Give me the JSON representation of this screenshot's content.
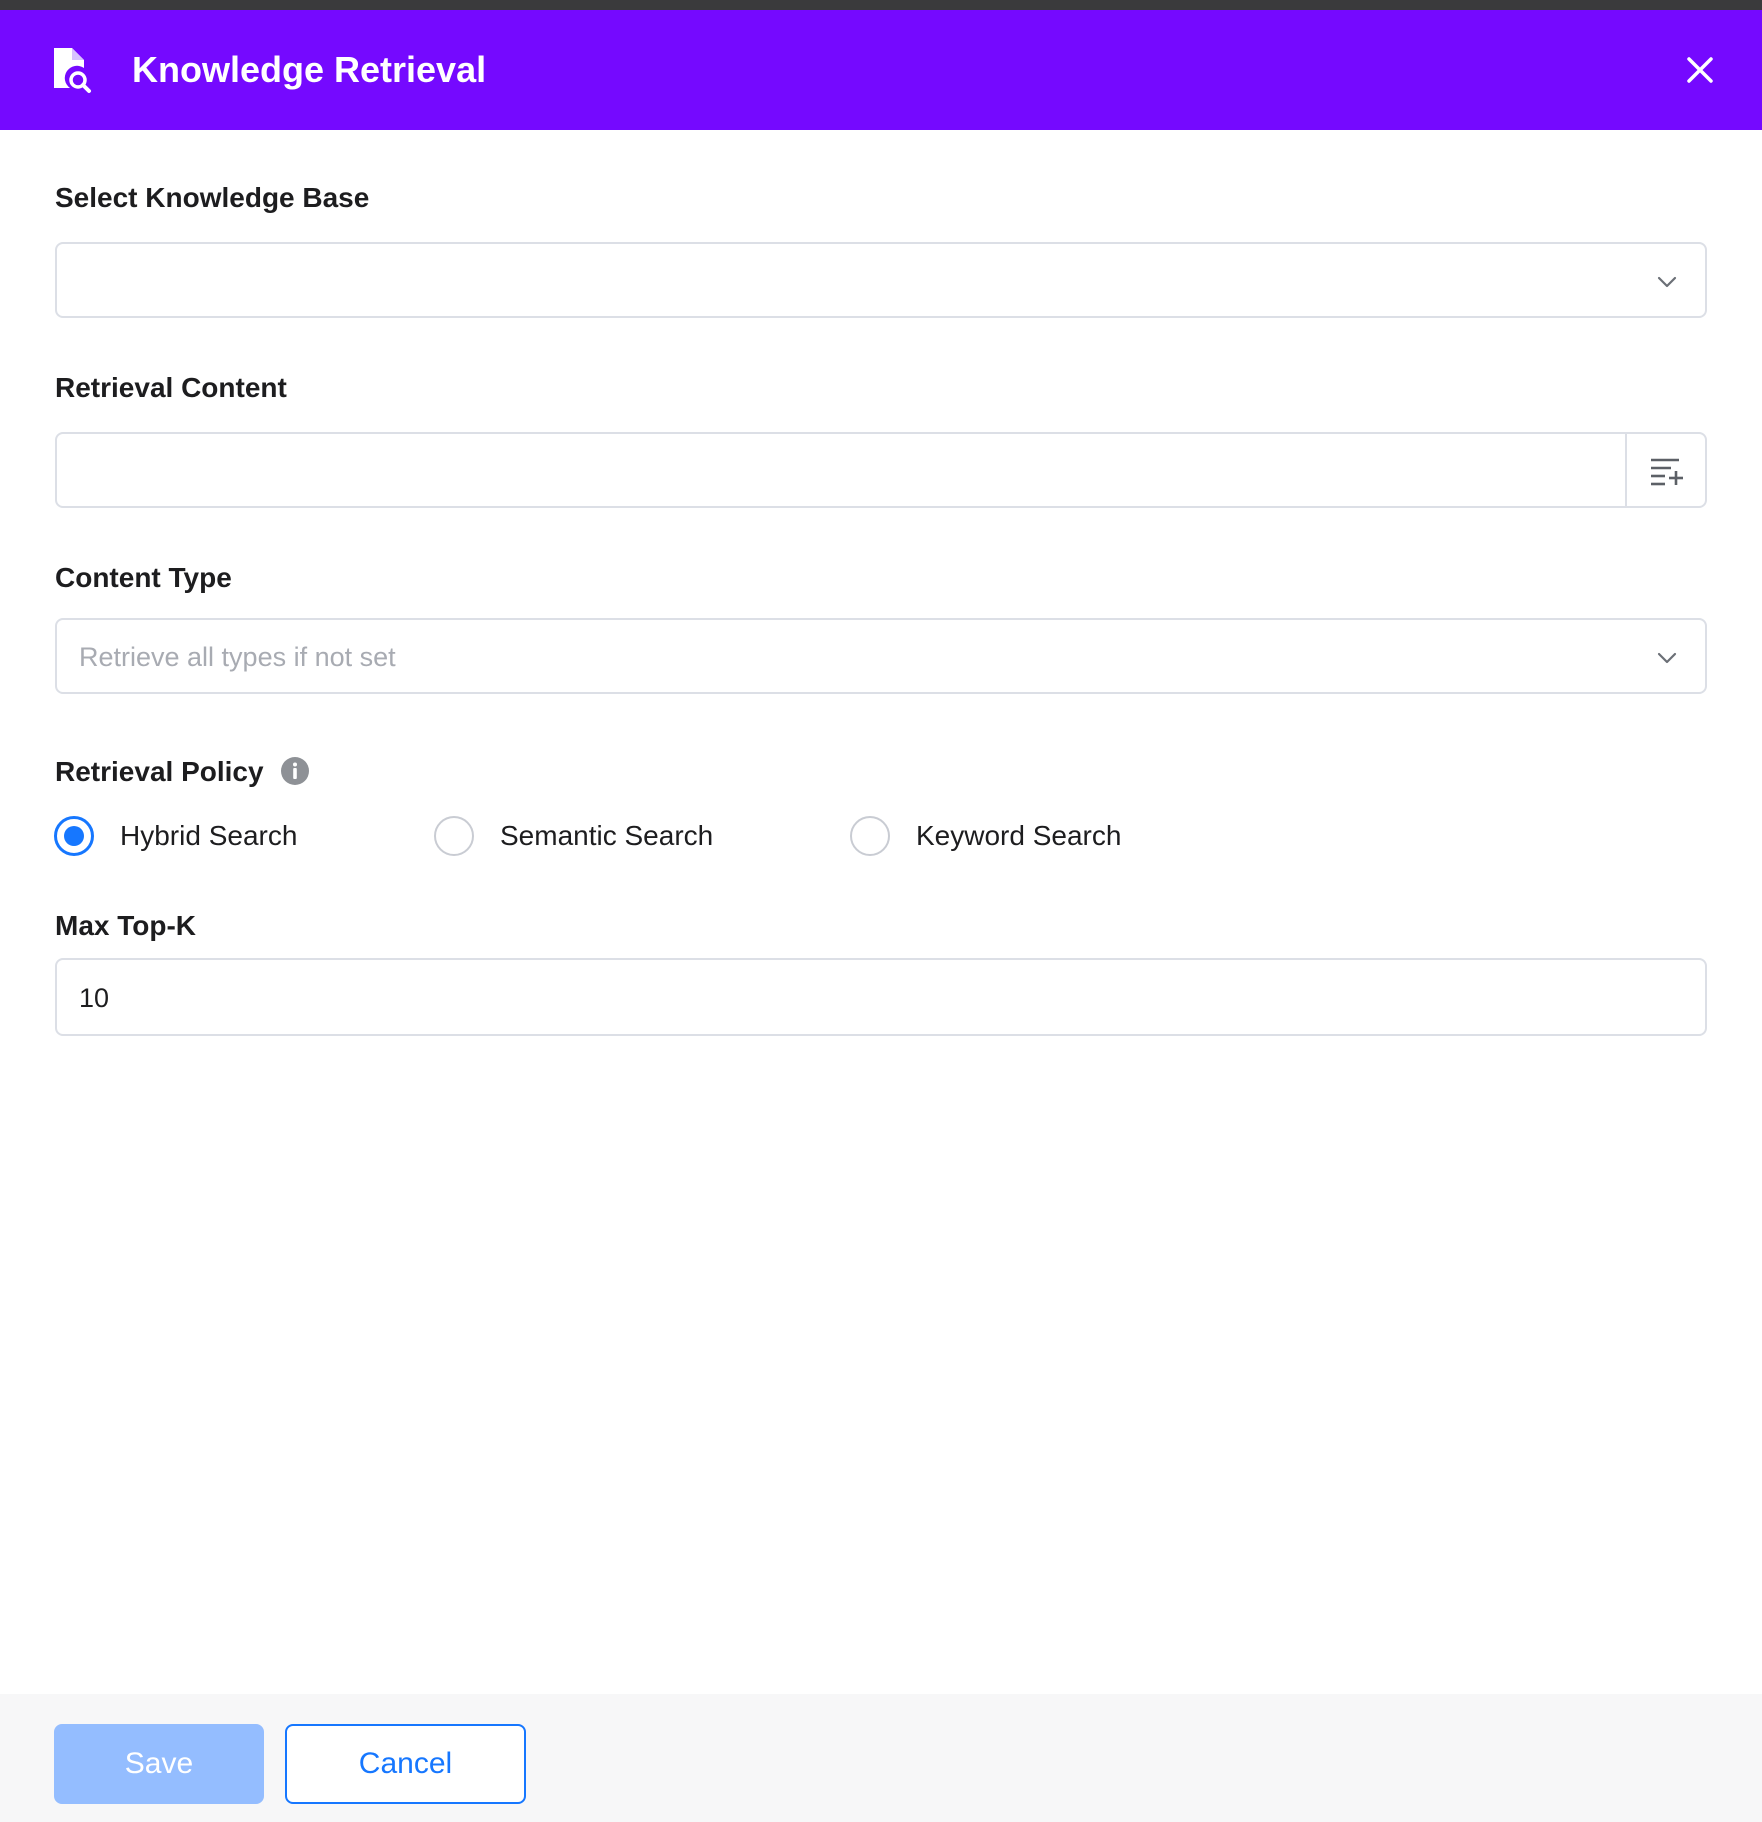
{
  "dialog": {
    "title": "Knowledge Retrieval",
    "header_icon": "file-search-icon",
    "close_icon": "close-icon",
    "accent_color": "#7509ff"
  },
  "knowledge_base": {
    "label": "Select Knowledge Base",
    "value": "",
    "placeholder": ""
  },
  "retrieval_content": {
    "label": "Retrieval Content",
    "value": "",
    "addon_icon": "insert-variable-icon"
  },
  "content_type": {
    "label": "Content Type",
    "placeholder": "Retrieve all types if not set"
  },
  "retrieval_policy": {
    "label": "Retrieval Policy",
    "info_icon": "info-icon",
    "options": [
      {
        "label": "Hybrid Search",
        "checked": true
      },
      {
        "label": "Semantic Search",
        "checked": false
      },
      {
        "label": "Keyword Search",
        "checked": false
      }
    ]
  },
  "max_top_k": {
    "label": "Max Top-K",
    "value": "10"
  },
  "footer": {
    "save_label": "Save",
    "cancel_label": "Cancel",
    "primary_color": "#1677ff"
  }
}
